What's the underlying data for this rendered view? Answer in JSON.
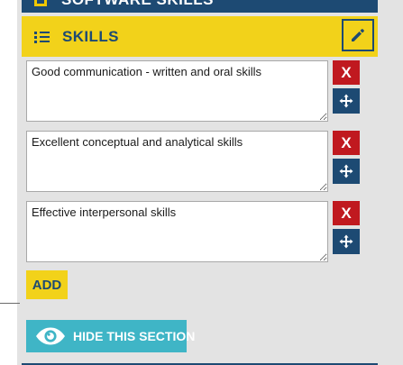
{
  "top_section": {
    "title": "SOFTWARE SKILLS"
  },
  "skills_section": {
    "title": "SKILLS",
    "list_icon": "list-icon",
    "edit_icon": "pencil-icon"
  },
  "skills": [
    {
      "value": "Good communication - written and oral skills",
      "delete_label": "X",
      "move_icon": "move-icon"
    },
    {
      "value": "Excellent conceptual and analytical skills",
      "delete_label": "X",
      "move_icon": "move-icon"
    },
    {
      "value": "Effective interpersonal skills",
      "delete_label": "X",
      "move_icon": "move-icon"
    }
  ],
  "add_button": {
    "label": "ADD"
  },
  "hide_button": {
    "label": "HIDE THIS SECTION",
    "icon": "eye-icon"
  },
  "colors": {
    "navy": "#1d4a73",
    "yellow": "#f2d21a",
    "red": "#c0191f",
    "teal": "#3fb5c6",
    "panel_bg": "#e3e3e3"
  }
}
